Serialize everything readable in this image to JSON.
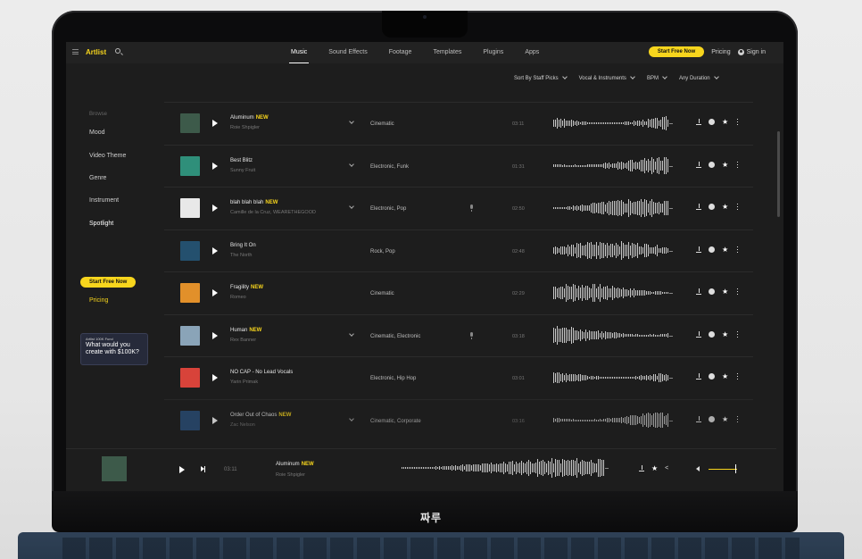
{
  "brand": {
    "logo": "Artlist",
    "device_label": "짜루"
  },
  "nav": {
    "tabs": [
      {
        "label": "Music",
        "active": true
      },
      {
        "label": "Sound Effects",
        "active": false
      },
      {
        "label": "Footage",
        "active": false
      },
      {
        "label": "Templates",
        "active": false
      },
      {
        "label": "Plugins",
        "active": false
      },
      {
        "label": "Apps",
        "active": false
      }
    ],
    "cta": "Start Free Now",
    "pricing": "Pricing",
    "signin": "Sign in"
  },
  "sidebar": {
    "browse_label": "Browse",
    "items": [
      "Mood",
      "Video Theme",
      "Genre",
      "Instrument",
      "Spotlight"
    ],
    "cta": "Start Free Now",
    "pricing": "Pricing",
    "promo": {
      "small": "Artlist 100K Fund",
      "big": "What would you create with $100K?"
    }
  },
  "filters": [
    "Sort By Staff Picks",
    "Vocal & Instruments",
    "BPM",
    "Any Duration"
  ],
  "tracks": [
    {
      "title": "Aluminum",
      "new": "NEW",
      "artist": "Roie Shpigler",
      "genre": "Cinematic",
      "duration": "03:11",
      "expand": true,
      "vocal": false
    },
    {
      "title": "Best Blitz",
      "new": "",
      "artist": "Sunny Fruit",
      "genre": "Electronic, Funk",
      "duration": "01:31",
      "expand": true,
      "vocal": false
    },
    {
      "title": "blah blah blah",
      "new": "NEW",
      "artist": "Camille de la Cruz, WEARETHEGOOD",
      "genre": "Electronic, Pop",
      "duration": "02:50",
      "expand": true,
      "vocal": true
    },
    {
      "title": "Bring It On",
      "new": "",
      "artist": "The North",
      "genre": "Rock, Pop",
      "duration": "02:48",
      "expand": false,
      "vocal": false
    },
    {
      "title": "Fragility",
      "new": "NEW",
      "artist": "Romeo",
      "genre": "Cinematic",
      "duration": "02:29",
      "expand": false,
      "vocal": false
    },
    {
      "title": "Human",
      "new": "NEW",
      "artist": "Rex Banner",
      "genre": "Cinematic, Electronic",
      "duration": "03:18",
      "expand": true,
      "vocal": true
    },
    {
      "title": "NO CAP - No Lead Vocals",
      "new": "",
      "artist": "Yarin Primak",
      "genre": "Electronic, Hip Hop",
      "duration": "03:01",
      "expand": false,
      "vocal": false
    },
    {
      "title": "Order Out of Chaos",
      "new": "NEW",
      "artist": "Zac Nelson",
      "genre": "Cinematic, Corporate",
      "duration": "03:16",
      "expand": true,
      "vocal": false
    }
  ],
  "cover_colors": [
    "#3d5a4a",
    "#2f8f7a",
    "#e8e8e8",
    "#24506e",
    "#e2902a",
    "#8aa4b8",
    "#d8433a",
    "#2a4f7a"
  ],
  "player": {
    "time": "03:11",
    "title": "Aluminum",
    "new": "NEW",
    "artist": "Roie Shpigler"
  },
  "colors": {
    "accent": "#f7d51d",
    "bg": "#1d1d1d",
    "text": "#d9d9d9"
  }
}
